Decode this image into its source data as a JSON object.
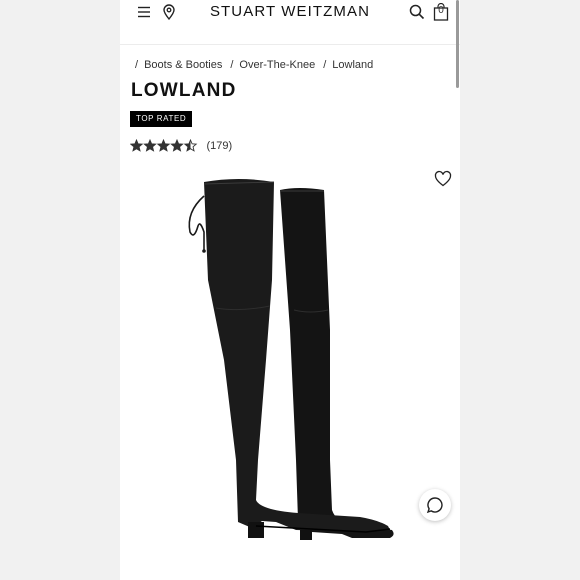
{
  "header": {
    "brand": "STUART WEITZMAN",
    "menu_icon": "hamburger-menu-icon",
    "location_icon": "map-pin-icon",
    "search_icon": "search-icon",
    "cart_icon": "shopping-bag-icon",
    "cart_count": "0"
  },
  "breadcrumb": {
    "separator": "/",
    "items": [
      {
        "label": "Boots & Booties"
      },
      {
        "label": "Over-The-Knee"
      },
      {
        "label": "Lowland"
      }
    ]
  },
  "product": {
    "name": "LOWLAND",
    "badge": "TOP RATED",
    "rating": 4.5,
    "rating_max": 5,
    "review_count": "(179)",
    "image_alt": "over-the-knee-boots-image",
    "favorite_icon": "heart-icon"
  },
  "chat": {
    "icon": "chat-bubble-icon"
  },
  "colors": {
    "background": "#f1f1f1",
    "surface": "#ffffff",
    "text": "#111111",
    "badge_bg": "#000000",
    "badge_text": "#ffffff",
    "boot": "#141414"
  }
}
